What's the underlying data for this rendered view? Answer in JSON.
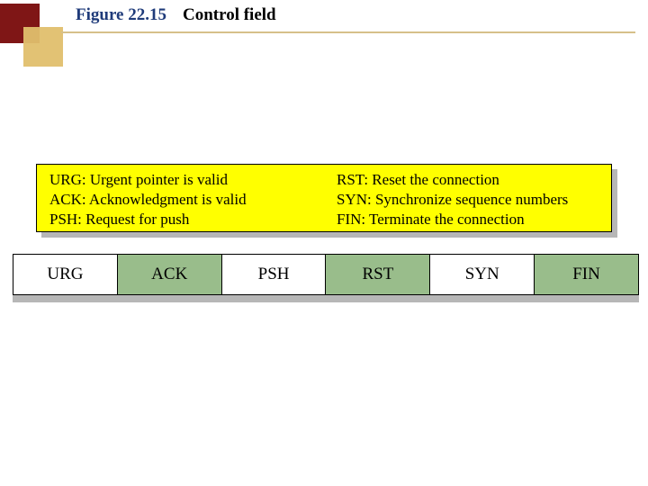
{
  "header": {
    "figure_number": "Figure 22.15",
    "figure_title": "Control field"
  },
  "legend": {
    "left": [
      "URG: Urgent pointer is valid",
      "ACK: Acknowledgment is valid",
      "PSH: Request for push"
    ],
    "right": [
      "RST: Reset the connection",
      "SYN: Synchronize sequence numbers",
      "FIN: Terminate the connection"
    ]
  },
  "flags": [
    {
      "label": "URG",
      "alt": false
    },
    {
      "label": "ACK",
      "alt": true
    },
    {
      "label": "PSH",
      "alt": false
    },
    {
      "label": "RST",
      "alt": true
    },
    {
      "label": "SYN",
      "alt": false
    },
    {
      "label": "FIN",
      "alt": true
    }
  ]
}
